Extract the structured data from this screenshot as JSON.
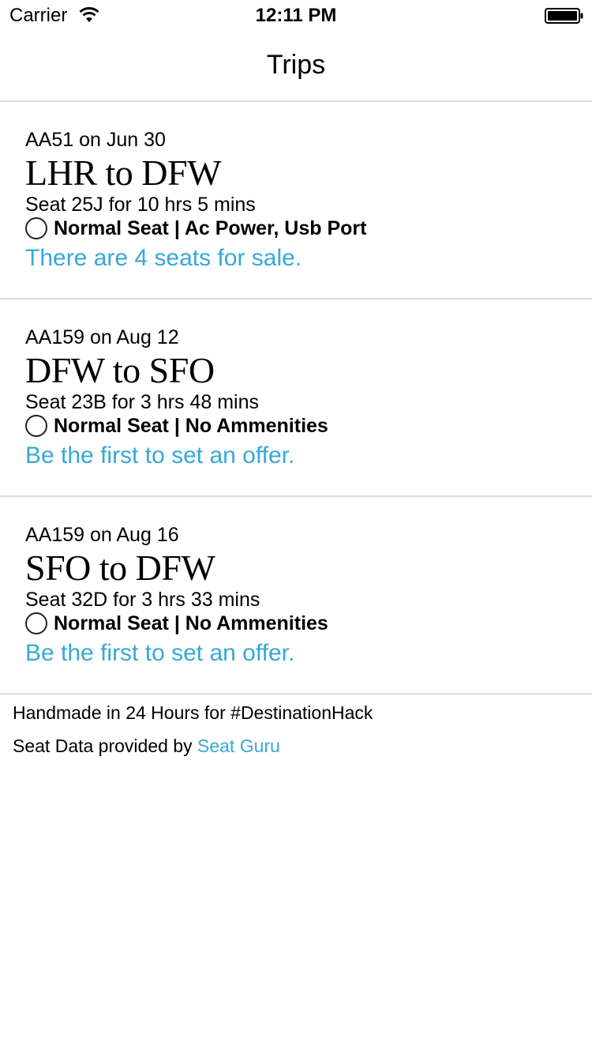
{
  "status_bar": {
    "carrier": "Carrier",
    "time": "12:11 PM",
    "wifi_icon": "wifi-icon",
    "battery_icon": "battery-icon"
  },
  "nav": {
    "title": "Trips"
  },
  "trips": [
    {
      "flight": "AA51 on Jun 30",
      "route": "LHR to DFW",
      "seat": "Seat 25J for 10 hrs 5 mins",
      "amenities": "Normal Seat | Ac Power, Usb Port",
      "offer": "There are 4 seats for sale."
    },
    {
      "flight": "AA159 on Aug 12",
      "route": "DFW to SFO",
      "seat": "Seat 23B for 3 hrs 48 mins",
      "amenities": "Normal Seat | No Ammenities",
      "offer": "Be the first to set an offer."
    },
    {
      "flight": "AA159 on Aug 16",
      "route": "SFO to DFW",
      "seat": "Seat 32D for 3 hrs 33 mins",
      "amenities": "Normal Seat | No Ammenities",
      "offer": "Be the first to set an offer."
    }
  ],
  "footer": {
    "handmade": "Handmade in 24 Hours for #DestinationHack",
    "data_prefix": "Seat Data provided by ",
    "data_link": "Seat Guru"
  },
  "colors": {
    "accent": "#36a8d8",
    "divider": "#dcdcdc",
    "text": "#000000",
    "background": "#ffffff"
  }
}
